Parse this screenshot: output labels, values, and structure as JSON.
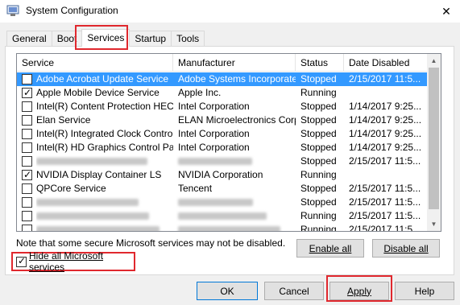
{
  "window": {
    "title": "System Configuration",
    "close_glyph": "✕"
  },
  "tabs": [
    {
      "label": "General",
      "active": false
    },
    {
      "label": "Boot",
      "active": false
    },
    {
      "label": "Services",
      "active": true
    },
    {
      "label": "Startup",
      "active": false
    },
    {
      "label": "Tools",
      "active": false
    }
  ],
  "list": {
    "headers": [
      "Service",
      "Manufacturer",
      "Status",
      "Date Disabled"
    ],
    "rows": [
      {
        "service": "Adobe Acrobat Update Service",
        "manufacturer": "Adobe Systems Incorporated",
        "status": "Stopped",
        "date": "2/15/2017 11:5...",
        "checked": false,
        "selected": true
      },
      {
        "service": "Apple Mobile Device Service",
        "manufacturer": "Apple Inc.",
        "status": "Running",
        "date": "",
        "checked": true,
        "selected": false
      },
      {
        "service": "Intel(R) Content Protection HEC...",
        "manufacturer": "Intel Corporation",
        "status": "Stopped",
        "date": "1/14/2017 9:25...",
        "checked": false,
        "selected": false
      },
      {
        "service": "Elan Service",
        "manufacturer": "ELAN Microelectronics Corp.",
        "status": "Stopped",
        "date": "1/14/2017 9:25...",
        "checked": false,
        "selected": false
      },
      {
        "service": "Intel(R) Integrated Clock Contro...",
        "manufacturer": "Intel Corporation",
        "status": "Stopped",
        "date": "1/14/2017 9:25...",
        "checked": false,
        "selected": false
      },
      {
        "service": "Intel(R) HD Graphics Control Pa...",
        "manufacturer": "Intel Corporation",
        "status": "Stopped",
        "date": "1/14/2017 9:25...",
        "checked": false,
        "selected": false
      },
      {
        "service": "",
        "manufacturer": "",
        "status": "Stopped",
        "date": "2/15/2017 11:5...",
        "checked": false,
        "selected": false,
        "blurred": true
      },
      {
        "service": "NVIDIA Display Container LS",
        "manufacturer": "NVIDIA Corporation",
        "status": "Running",
        "date": "",
        "checked": true,
        "selected": false
      },
      {
        "service": "QPCore Service",
        "manufacturer": "Tencent",
        "status": "Stopped",
        "date": "2/15/2017 11:5...",
        "checked": false,
        "selected": false
      },
      {
        "service": "",
        "manufacturer": "",
        "status": "Stopped",
        "date": "2/15/2017 11:5...",
        "checked": false,
        "selected": false,
        "blurred": true
      },
      {
        "service": "",
        "manufacturer": "",
        "status": "Running",
        "date": "2/15/2017 11:5...",
        "checked": false,
        "selected": false,
        "blurred": true
      },
      {
        "service": "",
        "manufacturer": "",
        "status": "Running",
        "date": "2/15/2017 11:5...",
        "checked": false,
        "selected": false,
        "blurred": true
      },
      {
        "service": "",
        "manufacturer": "",
        "status": "Running",
        "date": "2/15/2017 11:5...",
        "checked": false,
        "selected": false,
        "blurred": true
      }
    ]
  },
  "note": "Note that some secure Microsoft services may not be disabled.",
  "buttons": {
    "enable_all": "Enable all",
    "disable_all": "Disable all",
    "ok": "OK",
    "cancel": "Cancel",
    "apply": "Apply",
    "help": "Help"
  },
  "hide_ms": {
    "label": "Hide all Microsoft services",
    "checked": true
  },
  "colors": {
    "highlight": "#e0282e",
    "selection": "#3399ff"
  }
}
